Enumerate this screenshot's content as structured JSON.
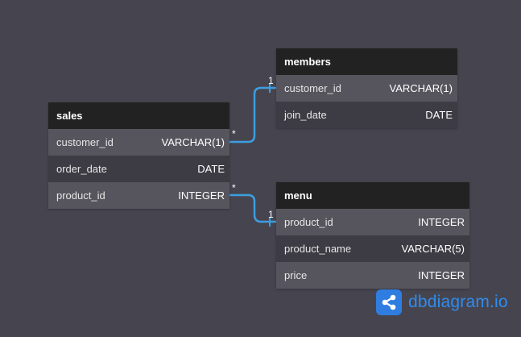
{
  "tables": {
    "sales": {
      "name": "sales",
      "columns": [
        {
          "name": "customer_id",
          "type": "VARCHAR(1)"
        },
        {
          "name": "order_date",
          "type": "DATE"
        },
        {
          "name": "product_id",
          "type": "INTEGER"
        }
      ]
    },
    "members": {
      "name": "members",
      "columns": [
        {
          "name": "customer_id",
          "type": "VARCHAR(1)"
        },
        {
          "name": "join_date",
          "type": "DATE"
        }
      ]
    },
    "menu": {
      "name": "menu",
      "columns": [
        {
          "name": "product_id",
          "type": "INTEGER"
        },
        {
          "name": "product_name",
          "type": "VARCHAR(5)"
        },
        {
          "name": "price",
          "type": "INTEGER"
        }
      ]
    }
  },
  "relationships": [
    {
      "from": "sales.customer_id",
      "to": "members.customer_id",
      "from_cardinality": "*",
      "to_cardinality": "1"
    },
    {
      "from": "sales.product_id",
      "to": "menu.product_id",
      "from_cardinality": "*",
      "to_cardinality": "1"
    }
  ],
  "brand": {
    "name": "dbdiagram.io",
    "color": "#2f8cf0",
    "icon": "share-nodes-icon"
  },
  "colors": {
    "background": "#46454f",
    "header": "#222222",
    "link": "#3d9ee0"
  }
}
